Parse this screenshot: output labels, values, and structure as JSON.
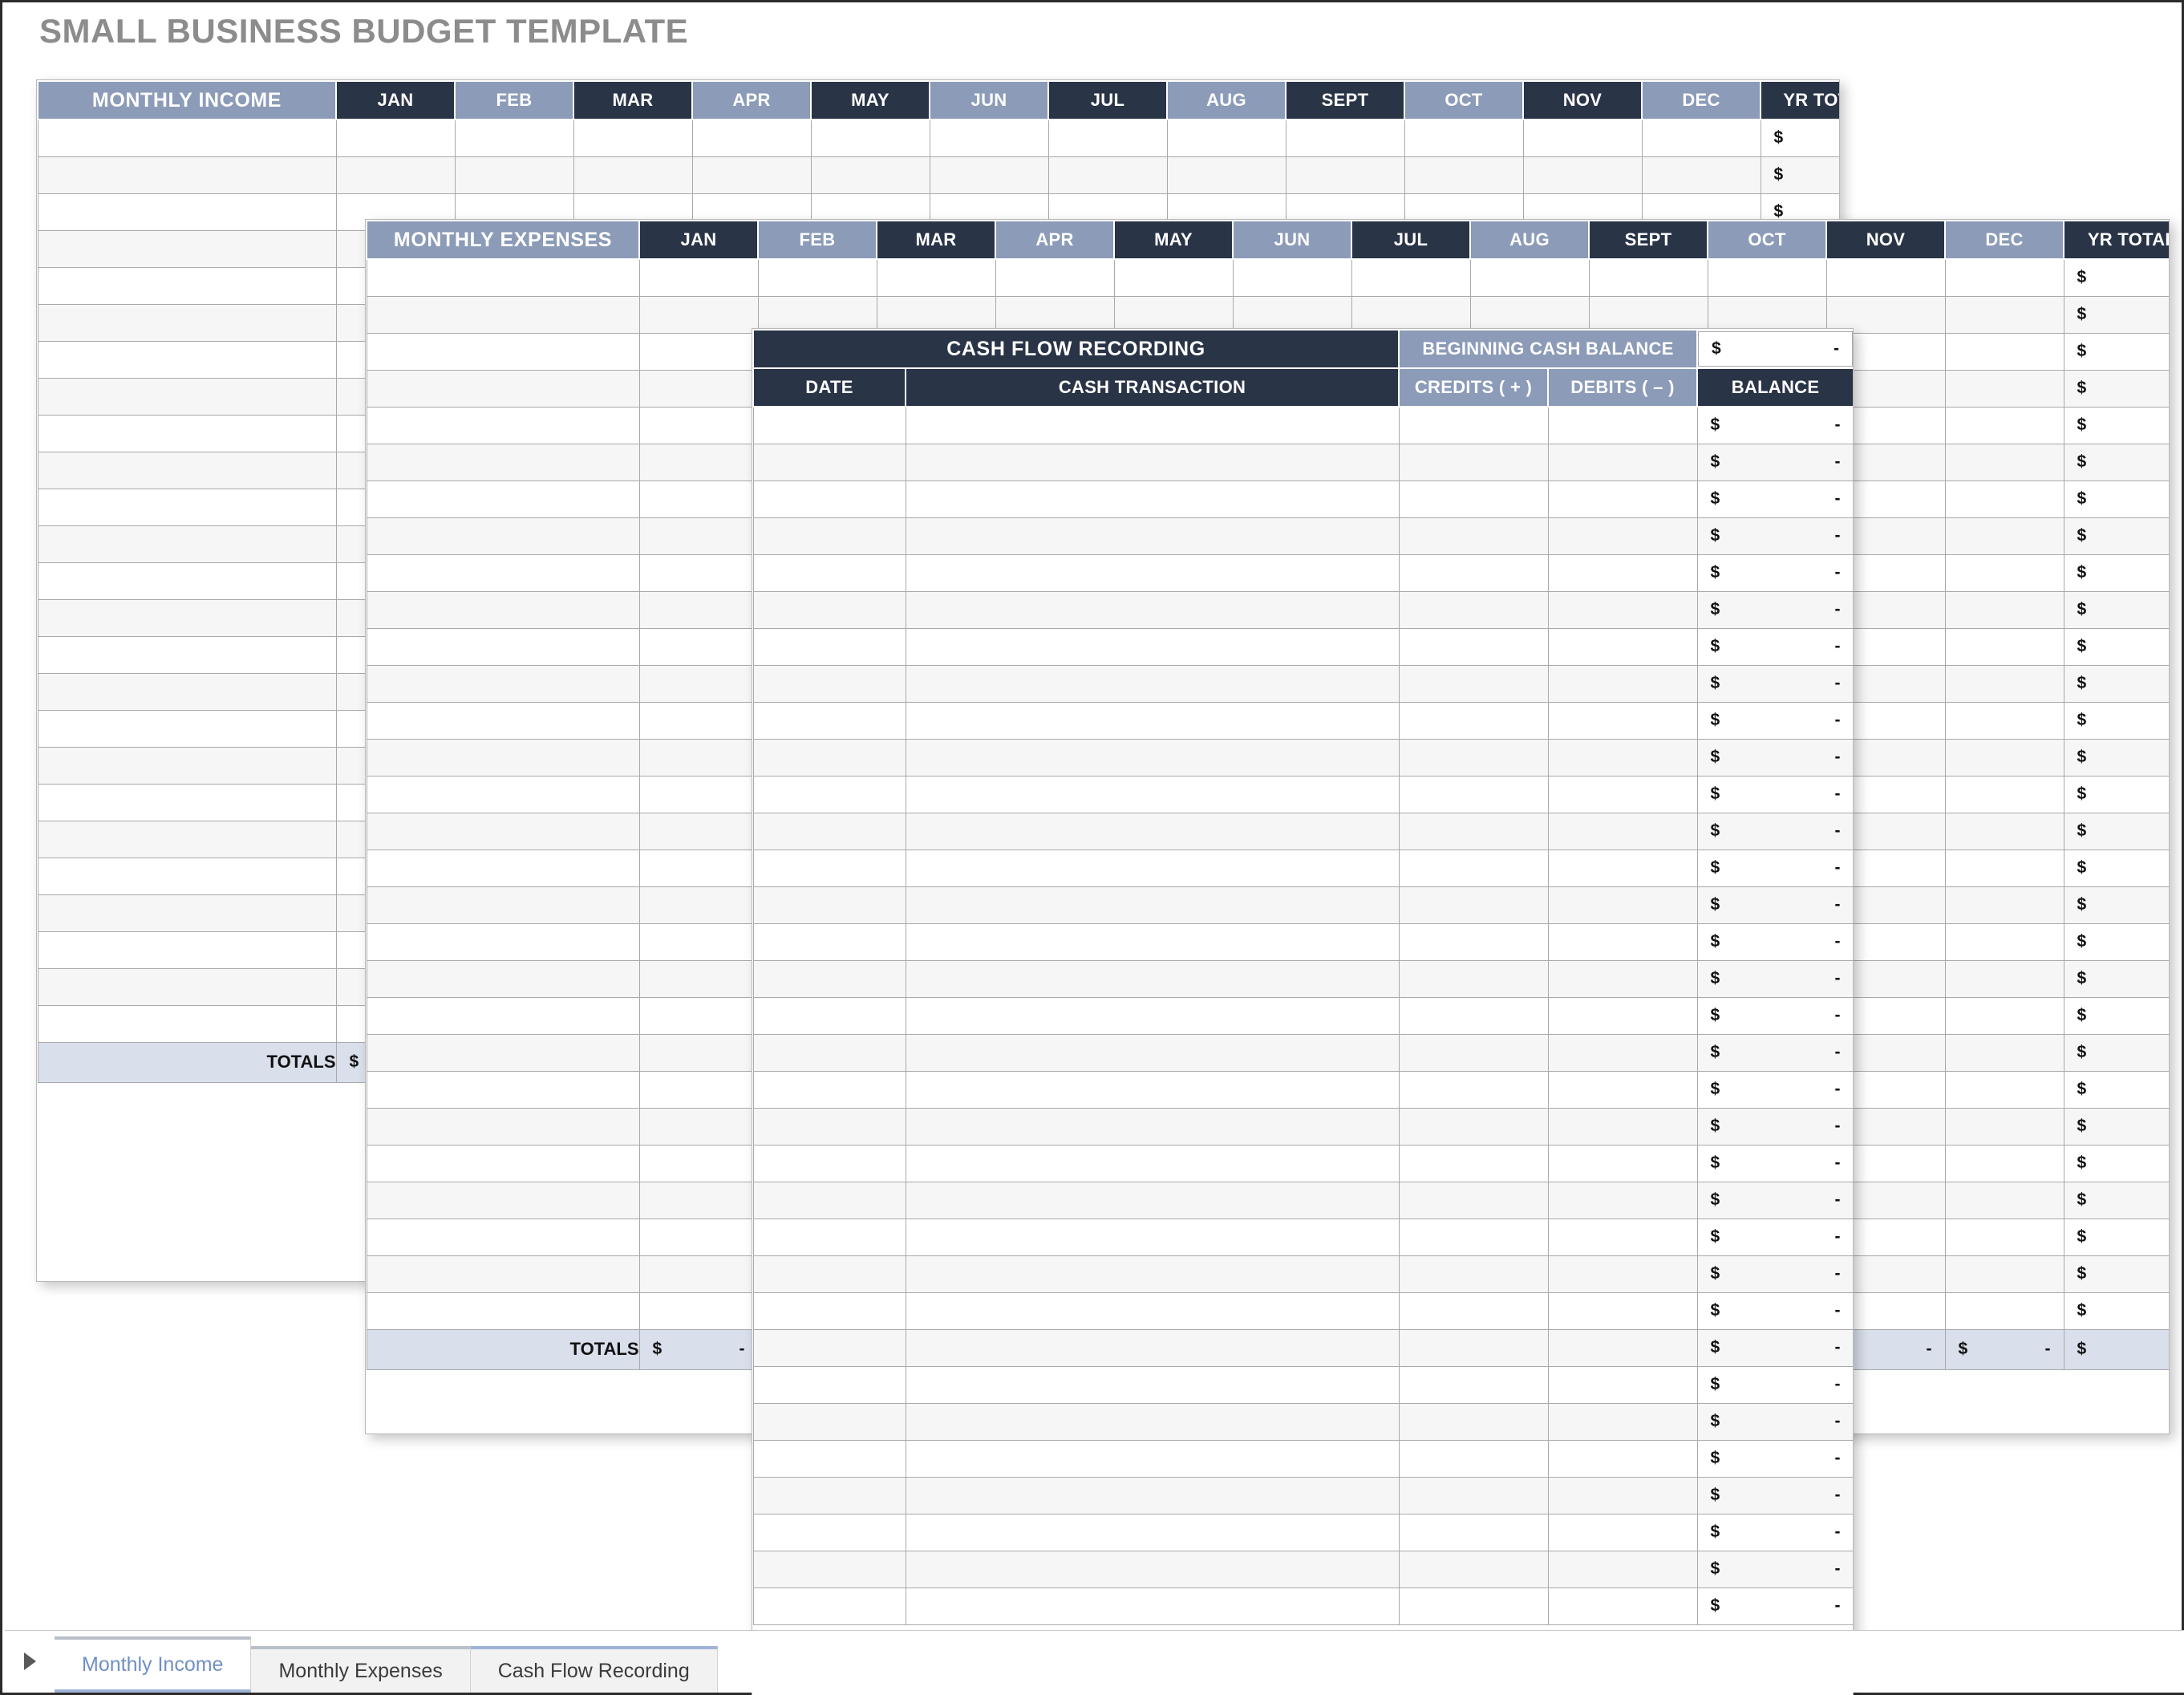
{
  "page": {
    "title": "SMALL BUSINESS BUDGET TEMPLATE"
  },
  "months": [
    "JAN",
    "FEB",
    "MAR",
    "APR",
    "MAY",
    "JUN",
    "JUL",
    "AUG",
    "SEPT",
    "OCT",
    "NOV",
    "DEC"
  ],
  "yr_total_label": "YR TOTAL",
  "money": {
    "symbol": "$",
    "value": "-"
  },
  "monthly_income": {
    "title": "MONTHLY INCOME",
    "row_count": 25,
    "totals_label": "TOTALS"
  },
  "monthly_expenses": {
    "title": "MONTHLY EXPENSES",
    "row_count": 29,
    "totals_label": "TOTALS"
  },
  "cash_flow": {
    "title": "CASH FLOW RECORDING",
    "beginning_label": "BEGINNING CASH BALANCE",
    "columns": {
      "date": "DATE",
      "transaction": "CASH TRANSACTION",
      "credits": "CREDITS ( + )",
      "debits": "DEBITS ( – )",
      "balance": "BALANCE"
    },
    "row_count": 33
  },
  "tabs": [
    {
      "label": "Monthly Income",
      "active": true
    },
    {
      "label": "Monthly Expenses",
      "active": false
    },
    {
      "label": "Cash Flow Recording",
      "active": false
    }
  ]
}
